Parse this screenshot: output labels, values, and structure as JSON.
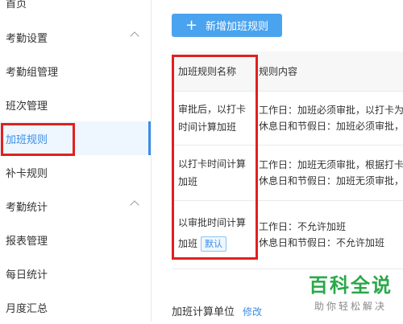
{
  "sidebar": {
    "items": [
      {
        "label": "首页"
      },
      {
        "label": "考勤设置"
      },
      {
        "label": "考勤组管理"
      },
      {
        "label": "班次管理"
      },
      {
        "label": "加班规则"
      },
      {
        "label": "补卡规则"
      },
      {
        "label": "考勤统计"
      },
      {
        "label": "报表管理"
      },
      {
        "label": "每日统计"
      },
      {
        "label": "月度汇总"
      }
    ],
    "active": "加班规则"
  },
  "toolbar": {
    "add_label": "新增加班规则",
    "add_icon": "plus-icon"
  },
  "table": {
    "headers": [
      "加班规则名称",
      "规则内容"
    ],
    "rows": [
      {
        "name_lines": [
          "审批后，以打卡",
          "时间计算加班"
        ],
        "content_lines": [
          "工作日：加班必须审批，以打卡为",
          "休息日和节假日：加班必须审批，"
        ]
      },
      {
        "name_lines": [
          "以打卡时间计算",
          "加班"
        ],
        "content_lines": [
          "工作日：加班无须审批，根据打卡",
          "休息日和节假日：加班无须审批，"
        ]
      },
      {
        "name_lines": [
          "以审批时间计算",
          "加班"
        ],
        "tag": "默认",
        "content_lines": [
          "工作日：不允许加班",
          "休息日和节假日：不允许加班"
        ]
      }
    ]
  },
  "section": {
    "title": "加班计算单位",
    "edit": "修改"
  },
  "watermark": {
    "main": "百科全说",
    "sub": "助你轻松解决"
  },
  "colors": {
    "accent": "#4aa3ee",
    "highlight_box": "#e02020",
    "watermark": "#2aa84a"
  }
}
